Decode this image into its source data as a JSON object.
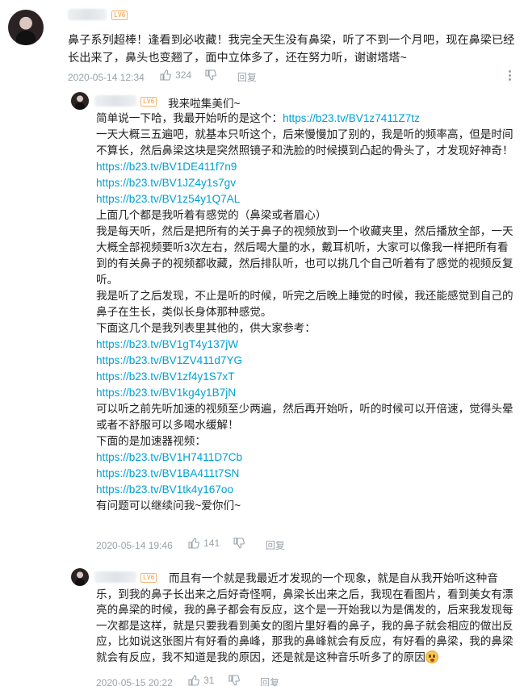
{
  "comment": {
    "badge": "LV6",
    "text": "鼻子系列超棒！逢看到必收藏！我完全天生没有鼻梁，听了不到一个月吧，现在鼻梁已经长出来了，鼻头也变翘了，面中立体多了，还在努力听，谢谢塔塔~",
    "time": "2020-05-14 12:34",
    "likes": "324",
    "reply_label": "回复"
  },
  "reply1": {
    "badge": "LV6",
    "header": "我来啦集美们~",
    "lines": [
      "简单说一下哈，我最开始听的是这个：",
      "https://b23.tv/BV1z7411Z7tz",
      "一天大概三五遍吧，就基本只听这个，后来慢慢加了别的，我是听的频率高，但是时间不算长，然后鼻梁这块是突然照镜子和洗脸的时候摸到凸起的骨头了，才发现好神奇！",
      "https://b23.tv/BV1DE411f7n9",
      "https://b23.tv/BV1JZ4y1s7gv",
      "https://b23.tv/BV1z54y1Q7AL",
      "上面几个都是我听着有感觉的（鼻梁或者眉心）",
      "我是每天听，然后是把所有的关于鼻子的视频放到一个收藏夹里，然后播放全部，一天大概全部视频要听3次左右，然后喝大量的水，戴耳机听，大家可以像我一样把所有看到的有关鼻子的视频都收藏，然后排队听，也可以挑几个自己听着有了感觉的视频反复听。",
      "我是听了之后发现，不止是听的时候，听完之后晚上睡觉的时候，我还能感觉到自己的鼻子在生长，类似长身体那种感觉。",
      "下面这几个是我列表里其他的，供大家参考：",
      "https://b23.tv/BV1gT4y137jW",
      "https://b23.tv/BV1ZV411d7YG",
      "https://b23.tv/BV1zf4y1S7xT",
      "https://b23.tv/BV1kg4y1B7jN",
      "可以听之前先听加速的视频至少两遍，然后再开始听，听的时候可以开倍速，觉得头晕或者不舒服可以多喝水缓解！",
      "下面的是加速器视频：",
      "https://b23.tv/BV1H7411D7Cb",
      "https://b23.tv/BV1BA411t7SN",
      "https://b23.tv/BV1tk4y167oo",
      "有问题可以继续问我~爱你们~"
    ],
    "time": "2020-05-14 19:46",
    "likes": "141",
    "reply_label": "回复"
  },
  "reply2": {
    "badge": "LV6",
    "text": "而且有一个就是我最近才发现的一个现象，就是自从我开始听这种音乐，到我的鼻子长出来之后好奇怪啊，鼻梁长出来之后，我现在看图片，看到美女有漂亮的鼻梁的时候，我的鼻子都会有反应，这个是一开始我以为是偶发的，后来我发现每一次都是这样，就是只要我看到美女的图片里好看的鼻子，我的鼻子就会相应的做出反应，比如说这张图片有好看的鼻峰，那我的鼻峰就会有反应，有好看的鼻梁，我的鼻梁就会有反应，我不知道是我的原因，还是就是这种音乐听多了的原因",
    "emoji_icon": "scared-face-emoji",
    "time": "2020-05-15 20:22",
    "likes": "31",
    "reply_label": "回复"
  },
  "icons": {
    "like": "thumbs-up-icon",
    "dislike": "thumbs-down-icon",
    "more": "more-vertical-icon"
  },
  "colors": {
    "link": "#00a1d6",
    "meta": "#99a2aa",
    "badge": "#f29a38"
  }
}
